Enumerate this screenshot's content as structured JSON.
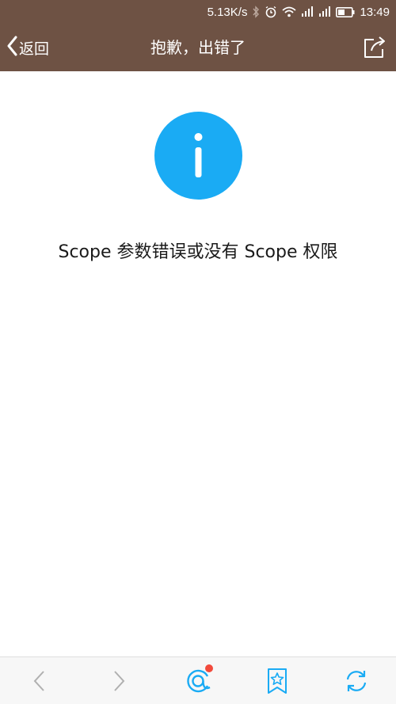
{
  "status_bar": {
    "net_speed": "5.13K/s",
    "time": "13:49",
    "icons": [
      "bluetooth-icon",
      "alarm-icon",
      "wifi-icon",
      "signal-icon",
      "signal-icon",
      "battery-icon"
    ]
  },
  "nav": {
    "back_label": "返回",
    "title": "抱歉，出错了",
    "share_icon": "share-icon"
  },
  "content": {
    "info_icon": "info-icon",
    "message": "Scope 参数错误或没有 Scope 权限"
  },
  "bottom_bar": {
    "items": [
      {
        "icon": "back-arrow-icon",
        "enabled": false
      },
      {
        "icon": "forward-arrow-icon",
        "enabled": false
      },
      {
        "icon": "home-icon",
        "badge": true
      },
      {
        "icon": "bookmark-star-icon"
      },
      {
        "icon": "refresh-icon"
      }
    ]
  },
  "colors": {
    "header_bg": "#6e5244",
    "accent": "#1aabf4",
    "badge": "#f24a3c",
    "disabled_icon": "#b0b0b0"
  }
}
